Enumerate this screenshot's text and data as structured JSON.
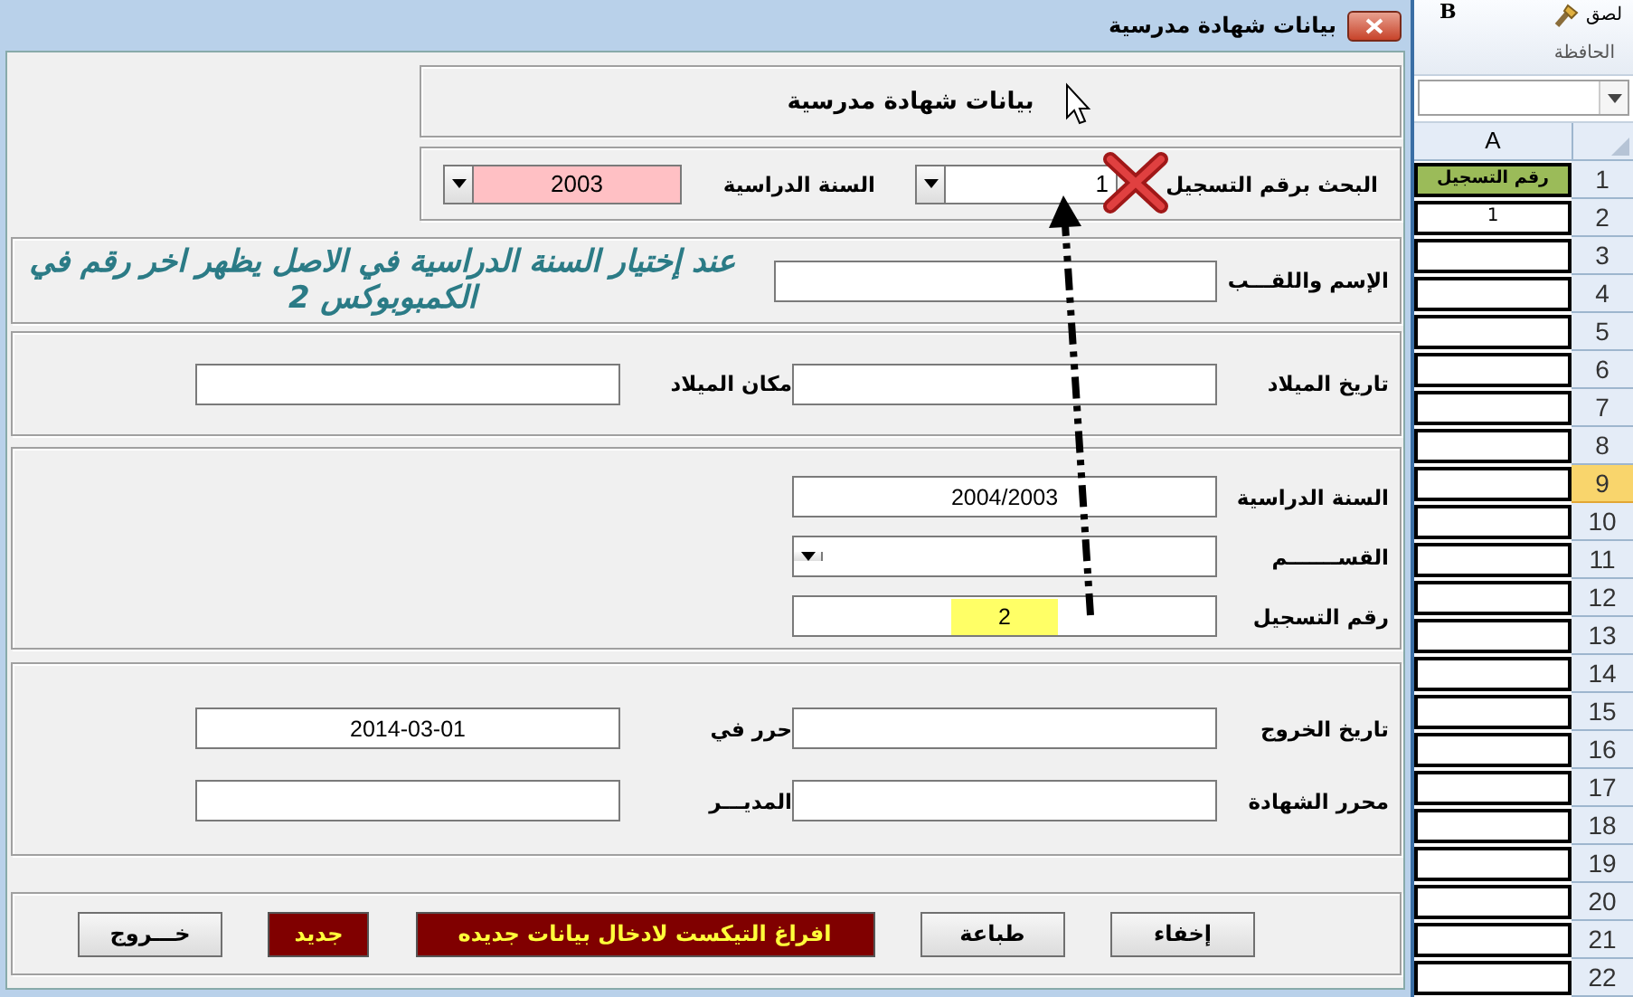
{
  "window": {
    "title": "بيانات شهادة مدرسية"
  },
  "header": {
    "title": "بيانات شهادة مدرسية"
  },
  "search": {
    "label": "البحث برقم التسجيل",
    "value": "1",
    "year_label": "السنة الدراسية",
    "year_value": "2003"
  },
  "student": {
    "name_label": "الإسم واللقـــب",
    "note": "عند إختيار السنة الدراسية في الاصل يظهر اخر رقم في الكمبوبوكس 2"
  },
  "birth": [
    {
      "label": "تاريخ الميلاد"
    },
    {
      "label": "مكان الميلاد"
    }
  ],
  "study": [
    {
      "label": "السنة الدراسية",
      "kind": "text",
      "value": "2004/2003",
      "highlighted": false
    },
    {
      "label": "القســـــــم",
      "kind": "combo",
      "highlighted": false
    },
    {
      "label": "رقم التسجيل",
      "kind": "text",
      "value": "2",
      "highlighted": true
    }
  ],
  "exit": [
    {
      "label": "تاريخ الخروج"
    },
    {
      "label": "حرر في",
      "value": "2014-03-01"
    },
    {
      "label": "محرر الشهادة"
    },
    {
      "label": "المديـــر"
    }
  ],
  "buttons": [
    {
      "label": "إخفاء",
      "kind": "normal"
    },
    {
      "label": "طباعة",
      "kind": "normal"
    },
    {
      "label": "افراغ التيكست لادخال بيانات جديده",
      "kind": "accent"
    },
    {
      "label": "جديد",
      "kind": "accent"
    },
    {
      "label": "خـــروج",
      "kind": "normal"
    }
  ],
  "ribbon": {
    "bold": "B",
    "paste": "لصق",
    "group": "الحافظة"
  },
  "sheet": {
    "column": "A",
    "rows": [
      {
        "number": "1",
        "cell": "رقم التسجيل",
        "selected": false
      },
      {
        "number": "2",
        "cell": "1",
        "selected": false
      },
      {
        "number": "3",
        "selected": false
      },
      {
        "number": "4",
        "selected": false
      },
      {
        "number": "5",
        "selected": false
      },
      {
        "number": "6",
        "selected": false
      },
      {
        "number": "7",
        "selected": false
      },
      {
        "number": "8",
        "selected": false
      },
      {
        "number": "9",
        "selected": true
      },
      {
        "number": "10",
        "selected": false
      },
      {
        "number": "11",
        "selected": false
      },
      {
        "number": "12",
        "selected": false
      },
      {
        "number": "13",
        "selected": false
      },
      {
        "number": "14",
        "selected": false
      },
      {
        "number": "15",
        "selected": false
      },
      {
        "number": "16",
        "selected": false
      },
      {
        "number": "17",
        "selected": false
      },
      {
        "number": "18",
        "selected": false
      },
      {
        "number": "19",
        "selected": false
      },
      {
        "number": "20",
        "selected": false
      },
      {
        "number": "21",
        "selected": false
      },
      {
        "number": "22",
        "selected": false
      }
    ]
  }
}
